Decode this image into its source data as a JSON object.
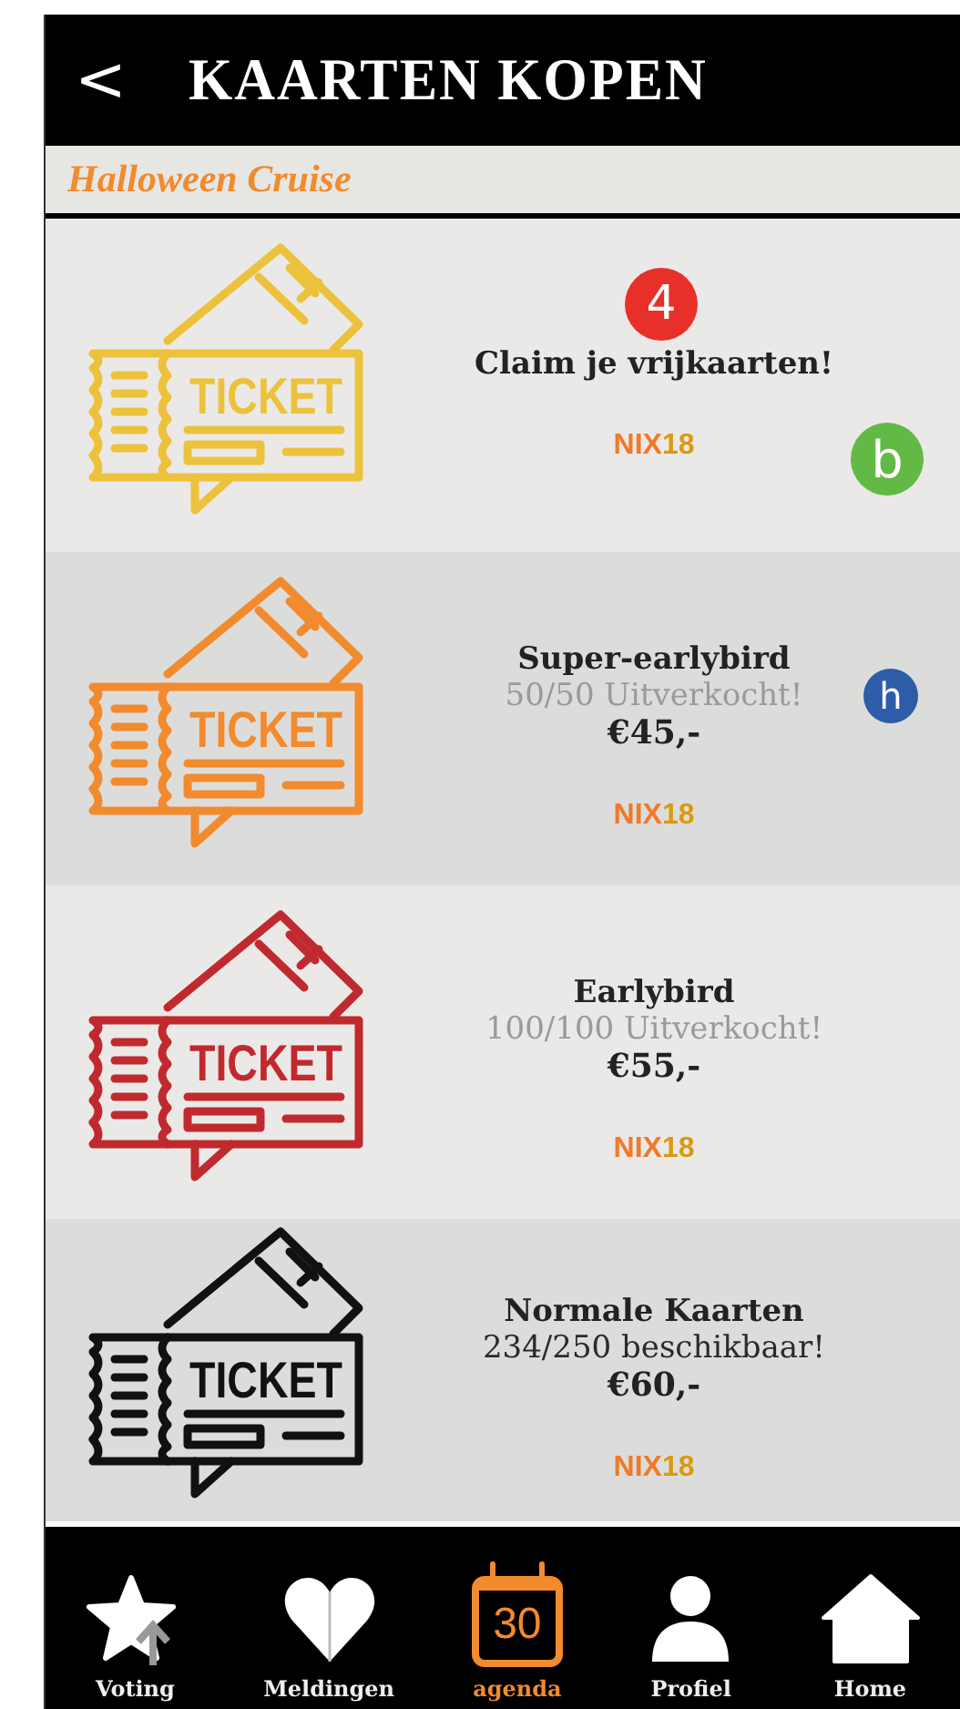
{
  "header": {
    "back_icon": "<",
    "title": "KAARTEN KOPEN"
  },
  "event": {
    "title": "Halloween Cruise"
  },
  "tickets": [
    {
      "name": "Claim je vrijkaarten!",
      "color": "#ecc23c",
      "stub_text": "TICKET",
      "age_logo": {
        "brand": "NIX",
        "age": "18"
      },
      "markers": [
        {
          "label": "4",
          "color": "#e8302b"
        },
        {
          "label": "b",
          "color": "#62b946"
        }
      ]
    },
    {
      "name": "Super-earlybird",
      "availability": "50/50 Uitverkocht!",
      "sold_out": true,
      "price": "€45,-",
      "color": "#f28a2e",
      "stub_text": "TICKET",
      "age_logo": {
        "brand": "NIX",
        "age": "18"
      },
      "markers": [
        {
          "label": "h",
          "color": "#2f5ca8"
        }
      ]
    },
    {
      "name": "Earlybird",
      "availability": "100/100 Uitverkocht!",
      "sold_out": true,
      "price": "€55,-",
      "color": "#c02a2f",
      "stub_text": "TICKET",
      "age_logo": {
        "brand": "NIX",
        "age": "18"
      }
    },
    {
      "name": "Normale Kaarten",
      "availability": "234/250 beschikbaar!",
      "sold_out": false,
      "price": "€60,-",
      "color": "#111111",
      "stub_text": "TICKET",
      "age_logo": {
        "brand": "NIX",
        "age": "18"
      }
    }
  ],
  "nav": [
    {
      "kind": "star",
      "label": "Voting",
      "selected": false
    },
    {
      "kind": "heart",
      "label": "Meldingen",
      "selected": false
    },
    {
      "kind": "calendar",
      "label": "agenda",
      "day": "30",
      "selected": true
    },
    {
      "kind": "person",
      "label": "Profiel",
      "selected": false
    },
    {
      "kind": "house",
      "label": "Home",
      "selected": false
    }
  ]
}
